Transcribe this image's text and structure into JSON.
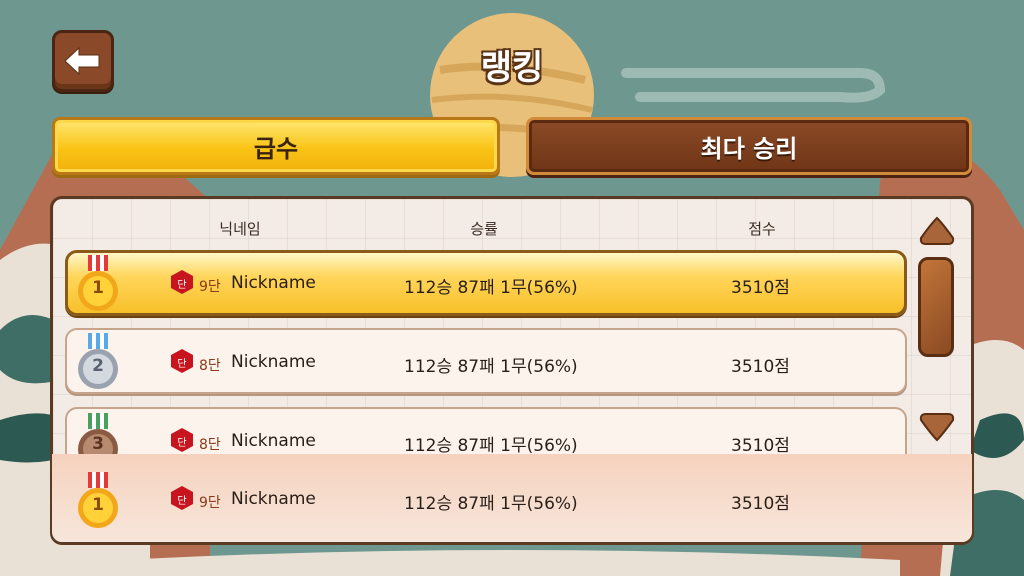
{
  "header": {
    "title": "랭킹"
  },
  "tabs": [
    {
      "label": "급수",
      "active": true
    },
    {
      "label": "최다 승리",
      "active": false
    }
  ],
  "table": {
    "columns": [
      "닉네임",
      "승률",
      "점수"
    ],
    "rows": [
      {
        "rank": "1",
        "medal": "gold",
        "grade_badge": "단",
        "grade": "9단",
        "nickname": "Nickname",
        "record": "112승 87패 1무(56%)",
        "score": "3510점"
      },
      {
        "rank": "2",
        "medal": "silver",
        "grade_badge": "단",
        "grade": "8단",
        "nickname": "Nickname",
        "record": "112승 87패 1무(56%)",
        "score": "3510점"
      },
      {
        "rank": "3",
        "medal": "bronze",
        "grade_badge": "단",
        "grade": "8단",
        "nickname": "Nickname",
        "record": "112승 87패 1무(56%)",
        "score": "3510점"
      }
    ],
    "my_row": {
      "rank": "1",
      "medal": "gold",
      "grade_badge": "단",
      "grade": "9단",
      "nickname": "Nickname",
      "record": "112승 87패 1무(56%)",
      "score": "3510점"
    }
  },
  "icons": {
    "back": "left-arrow-icon",
    "scroll_up": "triangle-up-icon",
    "scroll_down": "triangle-down-icon"
  },
  "colors": {
    "background": "#6e978f",
    "tab_active": "#f9c416",
    "tab_inactive": "#6f3516",
    "grade_badge": "#c8141e"
  }
}
